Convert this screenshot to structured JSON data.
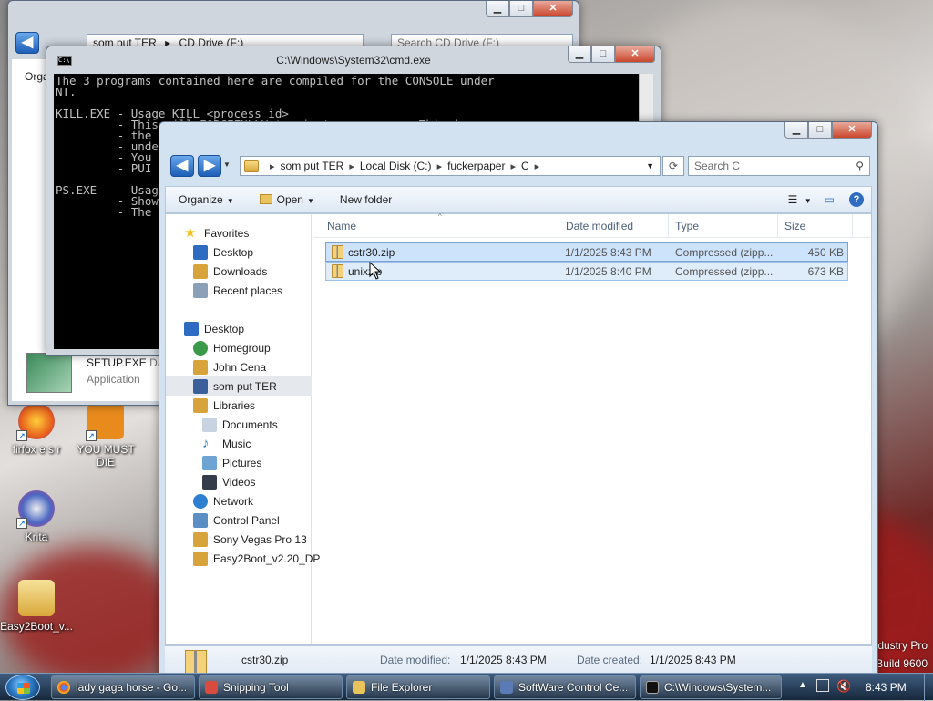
{
  "back_explorer": {
    "path": "som put TER",
    "drive": "CD Drive (F:)",
    "search_placeholder": "Search CD Drive (F:)",
    "organize": "Orga",
    "file_name": "SETUP.EXE",
    "file_type": "Application",
    "file_meta": "Dat"
  },
  "cmd": {
    "title": "C:\\Windows\\System32\\cmd.exe",
    "icon_text": "C:\\",
    "lines": "The 3 programs contained here are compiled for the CONSOLE under\nNT.\n\nKILL.EXE - Usage KILL <process id>\n         - This will FORCEFULLY terminate a process. This is\n         - the\n         - unde\n         - You\n         - PUI\n\nPS.EXE   - Usag\n         - Show\n         - The"
  },
  "explorer": {
    "back": "◀",
    "forward": "▶",
    "address": [
      "som put TER",
      "Local Disk (C:)",
      "fuckerpaper",
      "C"
    ],
    "search_placeholder": "Search C",
    "toolbar": {
      "organize": "Organize",
      "open": "Open",
      "new_folder": "New folder"
    },
    "columns": {
      "name": "Name",
      "date": "Date modified",
      "type": "Type",
      "size": "Size"
    },
    "nav": [
      {
        "label": "Favorites",
        "icon": "star-icon",
        "color": "#f3c11b"
      },
      {
        "label": "Desktop",
        "icon": "desktop-icon",
        "color": "#2e6cc2"
      },
      {
        "label": "Downloads",
        "icon": "downloads-icon",
        "color": "#d6a43a"
      },
      {
        "label": "Recent places",
        "icon": "recent-places-icon",
        "color": "#8aa0b6"
      },
      {
        "label": "Desktop",
        "icon": "desktop-icon",
        "color": "#2e6cc2"
      },
      {
        "label": "Homegroup",
        "icon": "homegroup-icon",
        "color": "#3a9a4a"
      },
      {
        "label": "John Cena",
        "icon": "user-folder-icon",
        "color": "#d6a43a"
      },
      {
        "label": "som put TER",
        "icon": "computer-icon",
        "color": "#3a5f9a"
      },
      {
        "label": "Libraries",
        "icon": "libraries-icon",
        "color": "#d6a43a"
      },
      {
        "label": "Documents",
        "icon": "documents-icon",
        "color": "#c7d3e0"
      },
      {
        "label": "Music",
        "icon": "music-icon",
        "color": "#2f7fd1"
      },
      {
        "label": "Pictures",
        "icon": "pictures-icon",
        "color": "#6ea4d4"
      },
      {
        "label": "Videos",
        "icon": "videos-icon",
        "color": "#333c48"
      },
      {
        "label": "Network",
        "icon": "network-icon",
        "color": "#2f7fd1"
      },
      {
        "label": "Control Panel",
        "icon": "control-panel-icon",
        "color": "#5b8fc4"
      },
      {
        "label": "Sony Vegas Pro 13",
        "icon": "folder-icon",
        "color": "#d6a43a"
      },
      {
        "label": "Easy2Boot_v2.20_DP",
        "icon": "folder-icon",
        "color": "#d6a43a"
      }
    ],
    "files": [
      {
        "name": "cstr30.zip",
        "date": "1/1/2025 8:43 PM",
        "type": "Compressed (zipp...",
        "size": "450 KB"
      },
      {
        "name": "unixzip",
        "date": "1/1/2025 8:40 PM",
        "type": "Compressed (zipp...",
        "size": "673 KB"
      }
    ],
    "details": {
      "name": "cstr30.zip",
      "modified_label": "Date modified:",
      "modified": "1/1/2025 8:43 PM",
      "created_label": "Date created:",
      "created": "1/1/2025 8:43 PM"
    }
  },
  "desktop": {
    "icons": [
      {
        "label": "firfox e s r",
        "color": "#e8611c"
      },
      {
        "label": "YOU MUST DIE",
        "color": "#e88a1c"
      },
      {
        "label": "Krita",
        "color": "#4a68c2"
      },
      {
        "label": "Easy2Boot_v...",
        "color": "#e9c45d"
      }
    ],
    "watermark_line1": "dustry Pro",
    "watermark_line2": "Build 9600"
  },
  "taskbar": {
    "buttons": [
      {
        "label": "lady gaga horse - Go...",
        "icon": "chrome-icon",
        "color": "#e0443a"
      },
      {
        "label": "Snipping Tool",
        "icon": "scissors-icon",
        "color": "#d94b3f"
      },
      {
        "label": "File Explorer",
        "icon": "folder-icon",
        "color": "#e9c45d"
      },
      {
        "label": "SoftWare Control Ce...",
        "icon": "app-icon",
        "color": "#5a7bb5"
      },
      {
        "label": "C:\\Windows\\System...",
        "icon": "cmd-icon",
        "color": "#111111"
      }
    ],
    "clock": "8:43 PM"
  }
}
